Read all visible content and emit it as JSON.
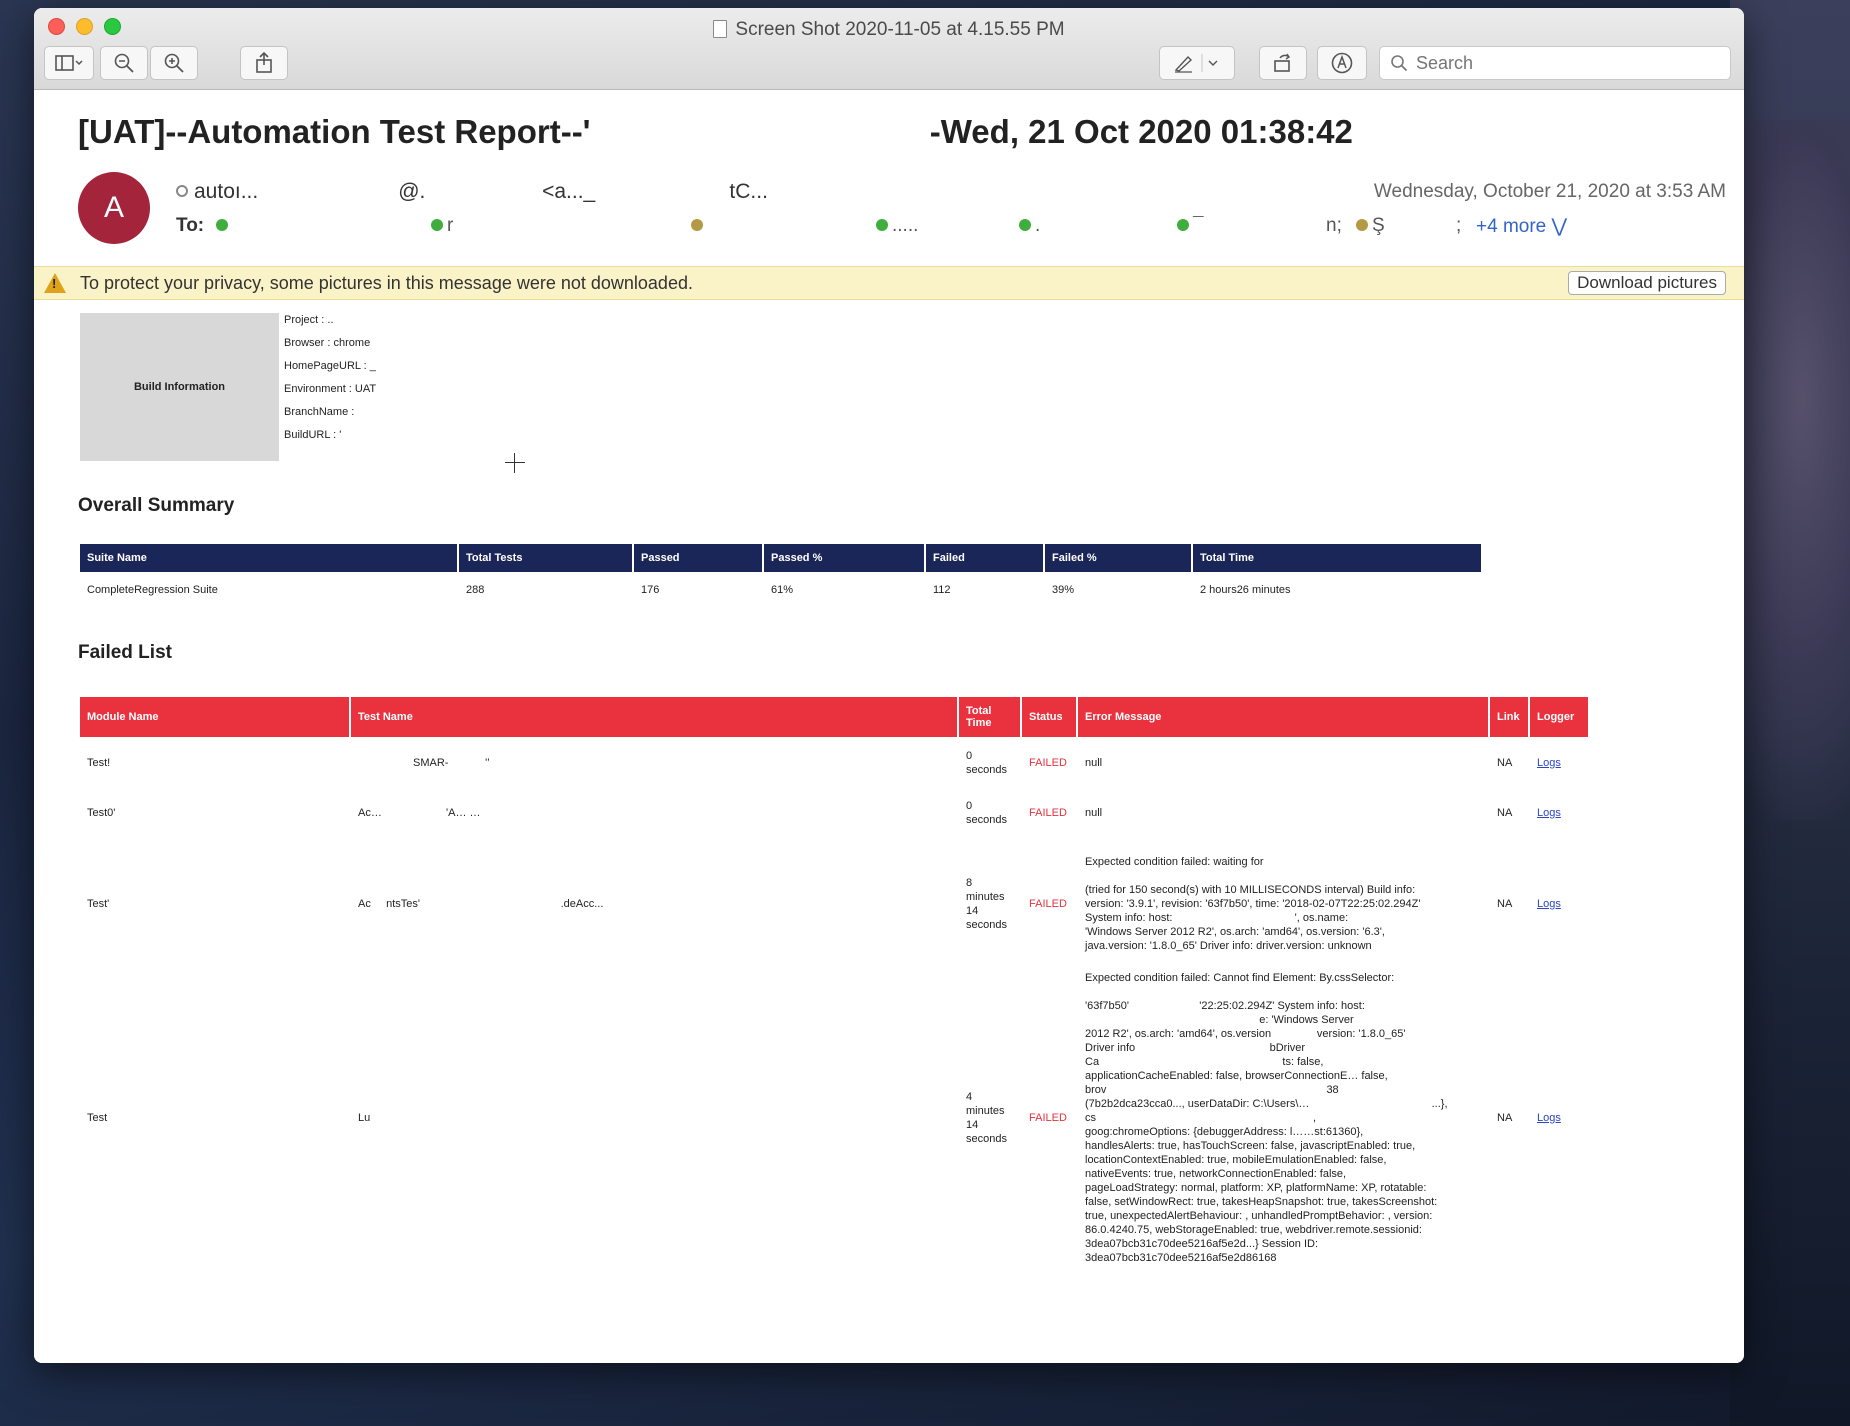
{
  "window": {
    "title": "Screen Shot 2020-11-05 at 4.15.55 PM",
    "search_placeholder": "Search"
  },
  "email": {
    "subject": "[UAT]--Automation Test Report--'                                     -Wed, 21 Oct 2020 01:38:42",
    "avatar_initial": "A",
    "from": "autoı...                        @.                    <a..._                       tC...",
    "date": "Wednesday, October 21, 2020 at 3:53 AM",
    "to_label": "To:",
    "recipients": [
      "",
      "r",
      "",
      ".....",
      ".",
      "¯",
      "n;",
      "Ş",
      ";"
    ],
    "more": "+4 more",
    "privacy_notice": "To protect your privacy, some pictures in this message were not downloaded.",
    "download_button": "Download pictures"
  },
  "build": {
    "box_label": "Build Information",
    "fields": [
      "Project : ..",
      "Browser : chrome",
      "HomePageURL : _",
      "Environment : UAT",
      "BranchName :",
      "BuildURL : '"
    ]
  },
  "summary": {
    "heading": "Overall Summary",
    "headers": [
      "Suite Name",
      "Total Tests",
      "Passed",
      "Passed %",
      "Failed",
      "Failed %",
      "Total Time"
    ],
    "row": [
      "CompleteRegression Suite",
      "288",
      "176",
      "61%",
      "112",
      "39%",
      "2 hours26 minutes"
    ]
  },
  "failed": {
    "heading": "Failed List",
    "headers": [
      "Module Name",
      "Test Name",
      "Total Time",
      "Status",
      "Error Message",
      "Link",
      "Logger"
    ],
    "rows": [
      {
        "module": "Test!",
        "test": "                  SMAR‐            '’",
        "time": "0\nseconds",
        "status": "FAILED",
        "error": "null",
        "link": "NA",
        "logger": "Logs"
      },
      {
        "module": "Test0'",
        "test": "Ac…                     'A… …",
        "time": "0\nseconds",
        "status": "FAILED",
        "error": "null",
        "link": "NA",
        "logger": "Logs"
      },
      {
        "module": "Test'",
        "test": "Ac     ntsTes'                                              .deAcc...",
        "time": "8\nminutes\n14\nseconds",
        "status": "FAILED",
        "error": "Expected condition failed: waiting for\n\n(tried for 150 second(s) with 10 MILLISECONDS interval) Build info:\nversion: '3.9.1', revision: '63f7b50', time: '2018-02-07T22:25:02.294Z'\nSystem info: host:                                        ', os.name:\n'Windows Server 2012 R2', os.arch: 'amd64', os.version: '6.3',\njava.version: '1.8.0_65' Driver info: driver.version: unknown",
        "link": "NA",
        "logger": "Logs"
      },
      {
        "module": "Test",
        "test": "Lu",
        "time": "4\nminutes\n14\nseconds",
        "status": "FAILED",
        "error": "Expected condition failed: Cannot find Element: By.cssSelector:\n\n'63f7b50'                       '22:25:02.294Z' System info: host:\n                                                         e: 'Windows Server\n2012 R2', os.arch: 'amd64', os.version               version: '1.8.0_65'\nDriver info                                            bDriver\nCa                                                            ts: false,\napplicationCacheEnabled: false, browserConnectionE… false,\nbrov                                                                        38\n(7b2b2dca23cca0..., userDataDir: C:\\Users\\…                                        ...},\ncs                                                                       ,\ngoog:chromeOptions: {debuggerAddress: l……st:61360},\nhandlesAlerts: true, hasTouchScreen: false, javascriptEnabled: true,\nlocationContextEnabled: true, mobileEmulationEnabled: false,\nnativeEvents: true, networkConnectionEnabled: false,\npageLoadStrategy: normal, platform: XP, platformName: XP, rotatable:\nfalse, setWindowRect: true, takesHeapSnapshot: true, takesScreenshot:\ntrue, unexpectedAlertBehaviour: , unhandledPromptBehavior: , version:\n86.0.4240.75, webStorageEnabled: true, webdriver.remote.sessionid:\n3dea07bcb31c70dee5216af5e2d...} Session ID:\n3dea07bcb31c70dee5216af5e2d86168",
        "link": "NA",
        "logger": "Logs"
      }
    ]
  },
  "colors": {
    "avatar": "#a3243b",
    "summary_header": "#1a2558",
    "failed_header": "#ea323f",
    "status_failed": "#e4323f",
    "link": "#2b45c9",
    "more_link": "#3264c8",
    "privacy_bg": "#fbf3c8"
  }
}
